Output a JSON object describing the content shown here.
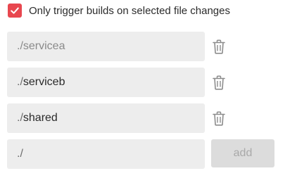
{
  "trigger": {
    "checked": true,
    "label": "Only trigger builds on selected file changes",
    "accent_color": "#e8474f"
  },
  "paths": [
    {
      "prefix": "./",
      "name": "servicea",
      "delete_icon": "trash-icon"
    },
    {
      "prefix": "./",
      "name": "serviceb",
      "delete_icon": "trash-icon"
    },
    {
      "prefix": "./",
      "name": "shared",
      "delete_icon": "trash-icon"
    }
  ],
  "new_path": {
    "value": "./"
  },
  "add_button": {
    "label": "add"
  }
}
